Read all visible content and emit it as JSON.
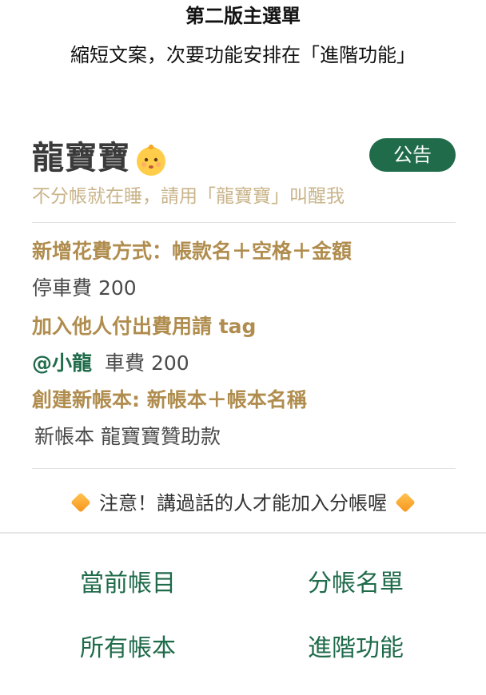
{
  "header": {
    "title": "第二版主選單",
    "subtitle": "縮短文案，次要功能安排在「進階功能」"
  },
  "bot": {
    "name": "龍寶寶",
    "name_icon": "baby-face-icon",
    "announce_label": "公告",
    "tagline": "不分帳就在睡，請用「龍寶寶」叫醒我"
  },
  "instructions": [
    {
      "title": "新增花費方式：帳款名＋空格＋金額",
      "example": "停車費 200"
    },
    {
      "title": "加入他人付出費用請 tag",
      "mention": "@小龍",
      "example": "車費 200"
    },
    {
      "title": "創建新帳本: 新帳本＋帳本名稱",
      "example": "新帳本 龍寶寶贊助款"
    }
  ],
  "notice": {
    "icon": "orange-diamond-icon",
    "text": "注意！講過話的人才能加入分帳喔"
  },
  "menu": {
    "current_items": "當前帳目",
    "split_list": "分帳名單",
    "all_books": "所有帳本",
    "advanced": "進階功能"
  },
  "colors": {
    "primary_green": "#1f6b4a",
    "gold": "#b08d4e",
    "tagline_gold": "#c9b48a",
    "notice_orange": "#f7941d"
  }
}
